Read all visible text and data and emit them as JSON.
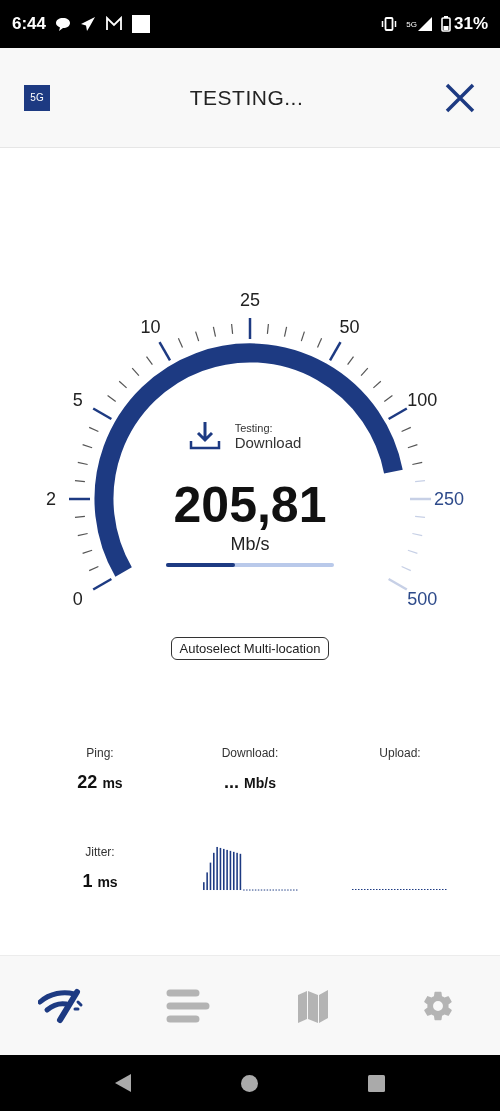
{
  "status_bar": {
    "time": "6:44",
    "network": "5G",
    "battery": "31%"
  },
  "header": {
    "badge": "5G",
    "title": "TESTING..."
  },
  "gauge": {
    "scale": [
      {
        "label": "0"
      },
      {
        "label": "2"
      },
      {
        "label": "5"
      },
      {
        "label": "10"
      },
      {
        "label": "25"
      },
      {
        "label": "50"
      },
      {
        "label": "100"
      },
      {
        "label": "250"
      },
      {
        "label": "500"
      }
    ]
  },
  "testing": {
    "label": "Testing:",
    "value": "Download"
  },
  "speed": {
    "value": "205,81",
    "unit": "Mb/s",
    "progress": {
      "level": 0.41
    }
  },
  "server_button": "Autoselect Multi-location",
  "results": [
    {
      "kind": "value",
      "label": "Ping:",
      "value": "22",
      "unit": "ms"
    },
    {
      "kind": "value",
      "label": "Download:",
      "value": "...",
      "unit": "Mb/s"
    },
    {
      "kind": "empty",
      "label": "Upload:"
    },
    {
      "kind": "value",
      "label": "Jitter:",
      "value": "1",
      "unit": "ms"
    },
    {
      "kind": "graph"
    },
    {
      "kind": "flat"
    }
  ],
  "bottom_nav": [
    {
      "kind": "speed",
      "selected": true
    },
    {
      "kind": "results",
      "selected": false
    },
    {
      "kind": "map",
      "selected": false
    },
    {
      "kind": "settings",
      "selected": false
    }
  ]
}
